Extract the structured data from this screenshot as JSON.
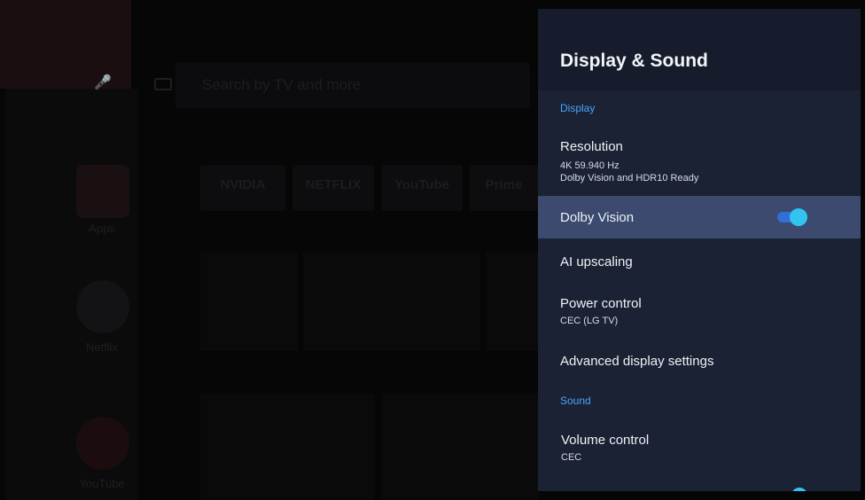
{
  "background": {
    "search_placeholder": "Search by TV and more",
    "rail": [
      {
        "label": "Apps"
      },
      {
        "label": "Netflix"
      },
      {
        "label": "YouTube"
      }
    ],
    "app_row": [
      "NVIDIA",
      "NETFLIX",
      "YouTube",
      "Prime"
    ]
  },
  "panel": {
    "title": "Display & Sound",
    "sections": {
      "display": "Display",
      "sound": "Sound"
    },
    "items": {
      "resolution": {
        "title": "Resolution",
        "line1": "4K 59.940 Hz",
        "line2": "Dolby Vision and HDR10 Ready"
      },
      "dolby_vision": {
        "title": "Dolby Vision",
        "toggle_on": true
      },
      "ai_upscaling": {
        "title": "AI upscaling"
      },
      "power_control": {
        "title": "Power control",
        "sub": "CEC (LG TV)"
      },
      "advanced_display": {
        "title": "Advanced display settings"
      },
      "volume_control": {
        "title": "Volume control",
        "sub": "CEC"
      }
    },
    "colors": {
      "panel_bg": "#1b2233",
      "focus_bg": "#3b4a6e",
      "accent": "#4aa3ff",
      "toggle_knob": "#32c4f0",
      "toggle_track": "#2f6fd6"
    }
  }
}
